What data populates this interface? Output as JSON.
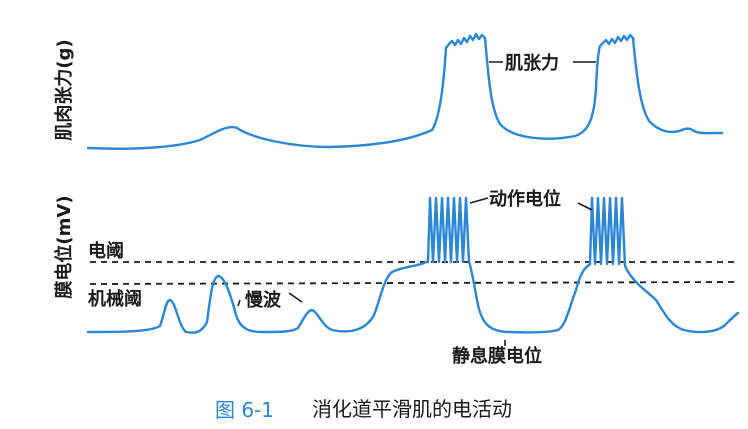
{
  "axes": {
    "top_ylabel": "肌肉张力(g)",
    "bottom_ylabel": "膜电位(mV)"
  },
  "annotations": {
    "muscle_tension": "肌张力",
    "action_potential": "动作电位",
    "electrical_threshold": "电阈",
    "mechanical_threshold": "机械阈",
    "slow_wave": "慢波",
    "resting_potential": "静息膜电位"
  },
  "caption": {
    "number": "图 6-1",
    "text": "消化道平滑肌的电活动"
  },
  "colors": {
    "trace": "#2b86d6",
    "text": "#1a1a1a",
    "caption_number": "#2b86d6"
  }
}
